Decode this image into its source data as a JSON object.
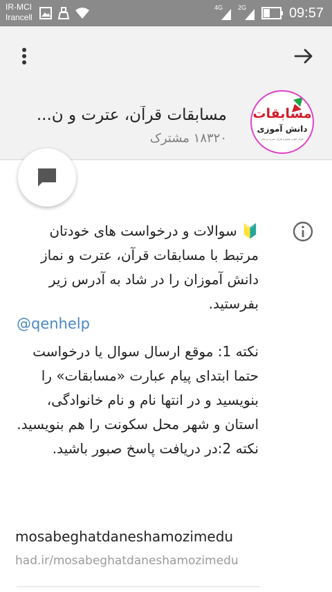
{
  "status_bar": {
    "carrier_line1": "IR-MCI",
    "carrier_line2": "Irancell",
    "signal_1_label": "4G",
    "signal_2_label": "2G",
    "time": "09:57",
    "icons": [
      "image-icon",
      "cleaner-icon",
      "wifi-icon",
      "signal-icon",
      "battery-icon"
    ]
  },
  "header": {
    "menu_icon": "more-vert-icon",
    "back_icon": "arrow-right-icon",
    "channel_title": "مسابقات قرآن، عترت و ن...",
    "subscribers": "۱۸۳۲۰ مشترک",
    "logo": {
      "line1": "مسابقات",
      "line2": "دانش آموزی",
      "tagline": "قرآن کتاب معجزه قرآن عترت و نماز"
    }
  },
  "fab": {
    "icon": "chat-bubble-icon"
  },
  "info": {
    "icon": "info-icon",
    "description_part1": "🔰 سوالات و درخواست های خودتان مرتبط با مسابقات قرآن، عترت و نماز دانش آموزان را در شاد به آدرس زیر بفرستید.",
    "username": "@qenhelp",
    "description_part2": "نکته 1: موقع ارسال سوال یا درخواست حتما ابتدای پیام عبارت «مسابقات» را بنویسید و در انتها نام و نام خانوادگی، استان و شهر محل سکونت را هم بنویسید.",
    "description_part3": "نکته 2:در دریافت پاسخ صبور باشید.",
    "link": "mosabeghatdaneshamozimedu",
    "link_sub": "had.ir/mosabeghatdaneshamozimedu"
  },
  "colors": {
    "status_bar": "#8a8a8a",
    "header_bg": "#f2f2f2",
    "link_blue": "#4b87c3",
    "avatar_ring": "#e040c8",
    "logo_red": "#d21f2b",
    "logo_green": "#1fa345"
  }
}
